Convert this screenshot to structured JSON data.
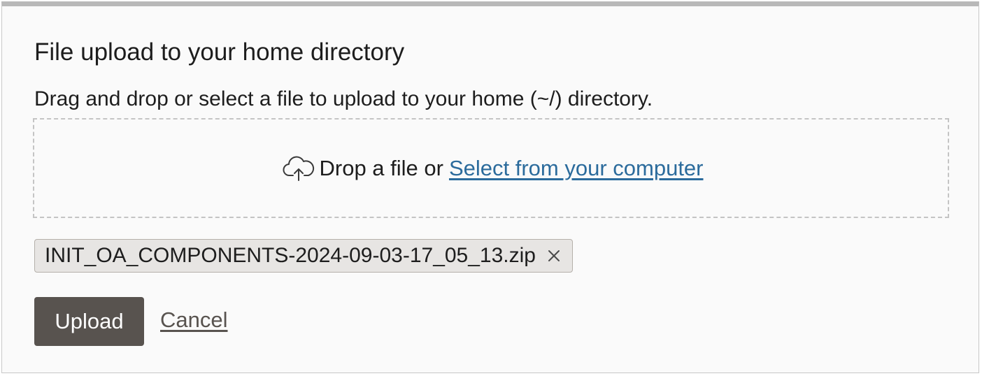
{
  "dialog": {
    "title": "File upload to your home directory",
    "description": "Drag and drop or select a file to upload to your home (~/) directory."
  },
  "dropzone": {
    "icon": "cloud-upload-icon",
    "text": "Drop a file or",
    "select_link": "Select from your computer"
  },
  "selected_file": {
    "name": "INIT_OA_COMPONENTS-2024-09-03-17_05_13.zip",
    "remove_icon": "close-icon"
  },
  "actions": {
    "upload_label": "Upload",
    "cancel_label": "Cancel"
  },
  "colors": {
    "link": "#2b6b9c",
    "primary_button": "#58534f",
    "chip_background": "#e7e5e3"
  }
}
